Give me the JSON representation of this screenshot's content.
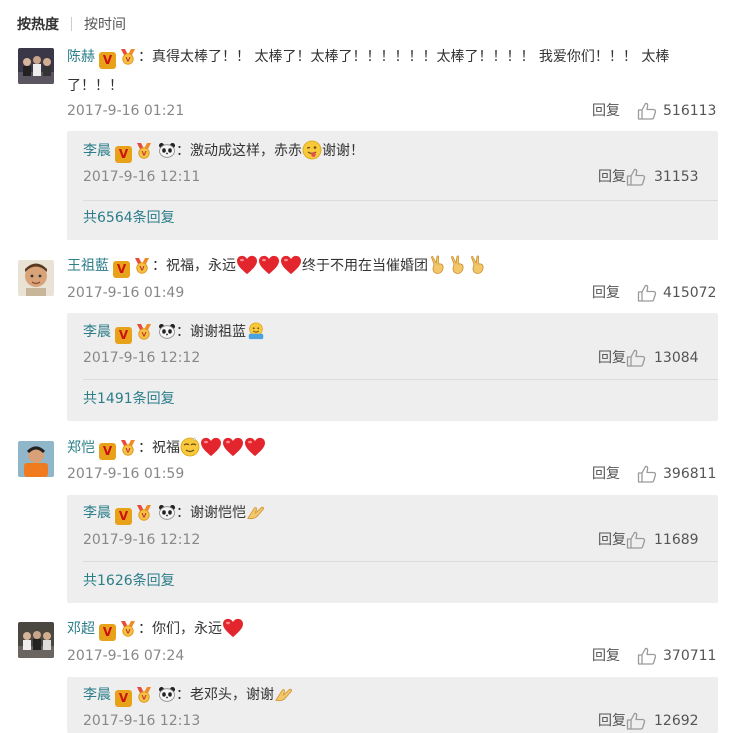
{
  "sort": {
    "hot": "按热度",
    "time": "按时间"
  },
  "colors": {
    "username": "#2b7e8a",
    "box": "#eeeeee"
  },
  "comments": [
    {
      "user": "陈赫",
      "text_a": "：真得太棒了！！ 太棒了！太棒了！！！！！！太棒了！！！！ 我爱你们！！！ 太棒",
      "text_b": "了！！！",
      "time": "2017-9-16 01:21",
      "reply_label": "回复",
      "likes": "516113",
      "sub": {
        "user": "李晨",
        "text_a": "：激动成这样，赤赤",
        "text_b": "谢谢！",
        "time": "2017-9-16 12:11",
        "reply_label": "回复",
        "likes": "31153"
      },
      "more": "共6564条回复"
    },
    {
      "user": "王祖藍",
      "text_a": "：祝福，永远",
      "text_b": "终于不用在当催婚团",
      "time": "2017-9-16 01:49",
      "reply_label": "回复",
      "likes": "415072",
      "sub": {
        "user": "李晨",
        "text_a": "：谢谢祖蓝",
        "time": "2017-9-16 12:12",
        "reply_label": "回复",
        "likes": "13084"
      },
      "more": "共1491条回复"
    },
    {
      "user": "郑恺",
      "text_a": "：祝福",
      "time": "2017-9-16 01:59",
      "reply_label": "回复",
      "likes": "396811",
      "sub": {
        "user": "李晨",
        "text_a": "：谢谢恺恺",
        "time": "2017-9-16 12:12",
        "reply_label": "回复",
        "likes": "11689"
      },
      "more": "共1626条回复"
    },
    {
      "user": "邓超",
      "text_a": "：你们，永远",
      "time": "2017-9-16 07:24",
      "reply_label": "回复",
      "likes": "370711",
      "sub": {
        "user": "李晨",
        "text_a": "：老邓头，谢谢",
        "time": "2017-9-16 12:13",
        "reply_label": "回复",
        "likes": "12692"
      }
    }
  ]
}
